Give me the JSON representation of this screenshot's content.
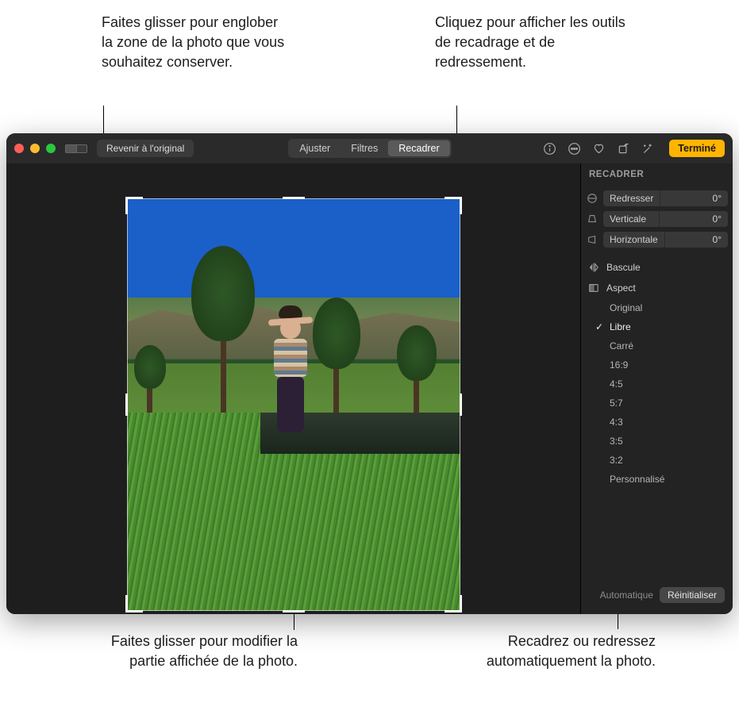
{
  "callouts": {
    "drag_keep": "Faites glisser pour englober la zone de la photo que vous souhaitez conserver.",
    "click_tools": "Cliquez pour afficher les outils de recadrage et de redressement.",
    "drag_change": "Faites glisser pour modifier la partie affichée de la photo.",
    "auto_recrop": "Recadrez ou redressez automatiquement la photo."
  },
  "toolbar": {
    "revert": "Revenir à l'original",
    "tabs": {
      "adjust": "Ajuster",
      "filters": "Filtres",
      "crop": "Recadrer"
    },
    "done": "Terminé"
  },
  "sidebar": {
    "title": "RECADRER",
    "sliders": {
      "straighten": {
        "label": "Redresser",
        "value": "0°"
      },
      "vertical": {
        "label": "Verticale",
        "value": "0°"
      },
      "horizontal": {
        "label": "Horizontale",
        "value": "0°"
      }
    },
    "flip": "Bascule",
    "aspect_header": "Aspect",
    "aspect_options": {
      "original": "Original",
      "free": "Libre",
      "square": "Carré",
      "r16_9": "16:9",
      "r4_5": "4:5",
      "r5_7": "5:7",
      "r4_3": "4:3",
      "r3_5": "3:5",
      "r3_2": "3:2",
      "custom": "Personnalisé"
    },
    "footer": {
      "auto": "Automatique",
      "reset": "Réinitialiser"
    }
  }
}
